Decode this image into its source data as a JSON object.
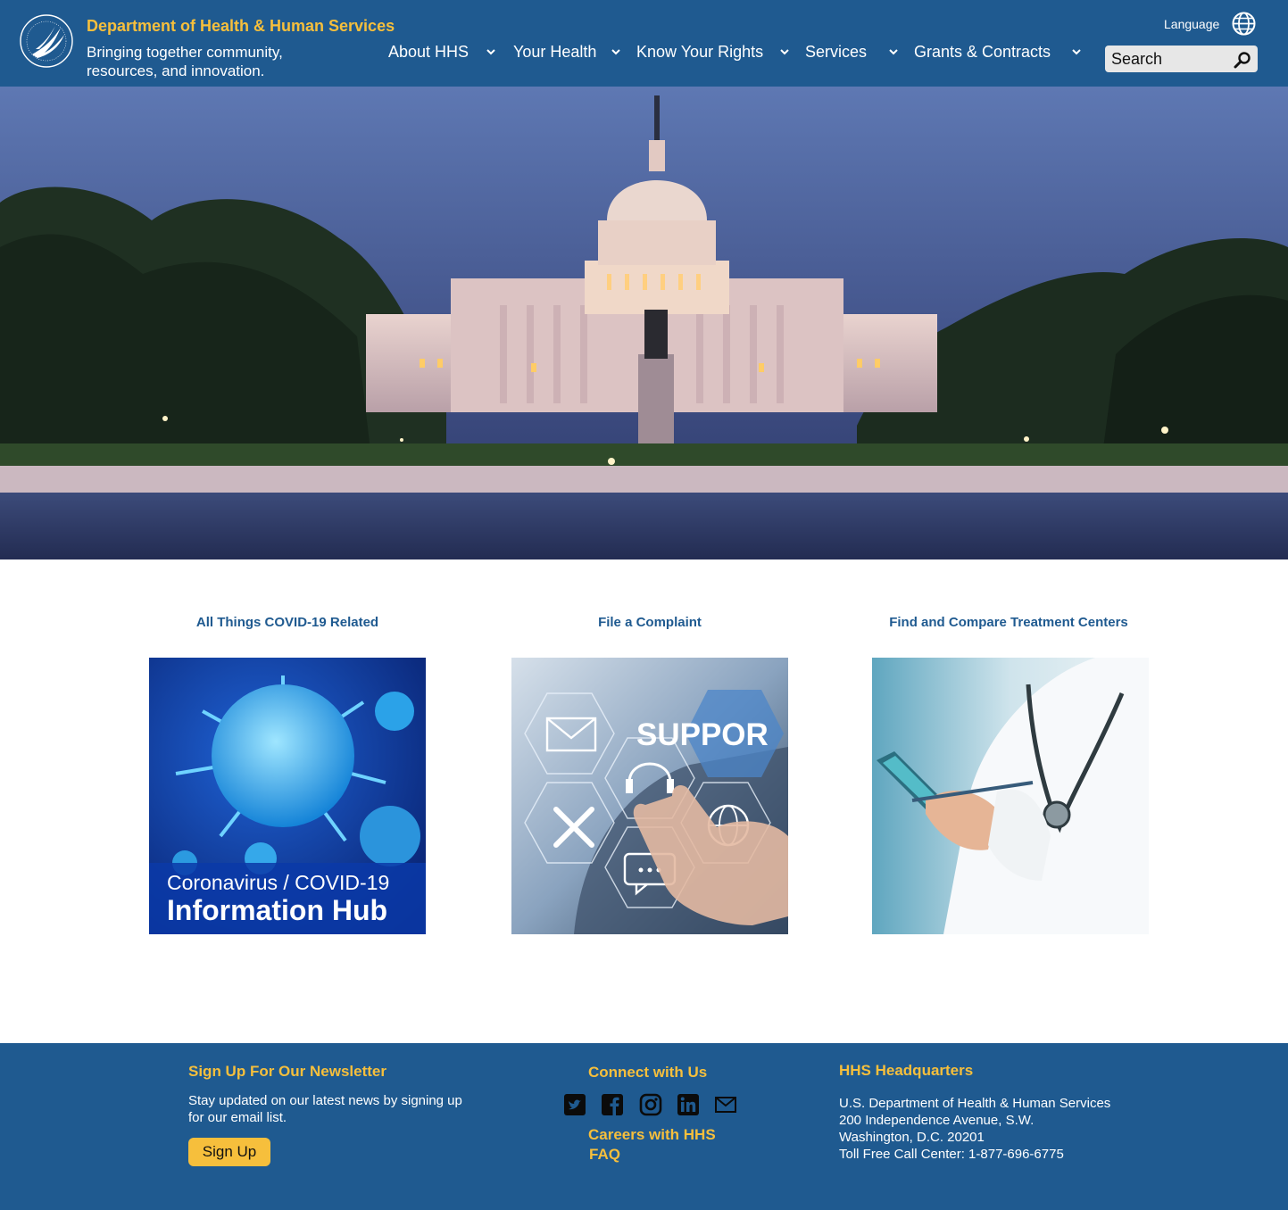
{
  "header": {
    "org_name": "Department of Health & Human Services",
    "tagline": "Bringing together community, resources, and innovation.",
    "language_label": "Language",
    "search_placeholder": "Search",
    "nav": [
      {
        "label": "About HHS"
      },
      {
        "label": "Your Health"
      },
      {
        "label": "Know Your Rights"
      },
      {
        "label": "Services"
      },
      {
        "label": "Grants & Contracts"
      }
    ]
  },
  "cards": [
    {
      "title": "All Things COVID-19 Related",
      "image_line1": "Coronavirus / COVID-19",
      "image_line2": "Information Hub"
    },
    {
      "title": "File a Complaint",
      "image_text": "SUPPOR"
    },
    {
      "title": "Find and Compare Treatment Centers"
    }
  ],
  "footer": {
    "newsletter_heading": "Sign Up For Our Newsletter",
    "newsletter_text": "Stay updated on our latest news by signing up for our email list.",
    "signup_label": "Sign Up",
    "connect_heading": "Connect with Us",
    "careers_link": "Careers with HHS",
    "faq_link": "FAQ",
    "hq_heading": "HHS Headquarters",
    "hq_lines": [
      "U.S. Department of Health & Human Services",
      "200 Independence Avenue, S.W.",
      "Washington, D.C. 20201",
      "Toll Free Call Center: 1-877-696-6775"
    ]
  },
  "colors": {
    "brand_blue": "#1f5a90",
    "accent_gold": "#f6bf3c"
  },
  "icons": [
    "hhs-eagle-logo",
    "globe-icon",
    "search-icon",
    "chevron-down-icon",
    "twitter-icon",
    "facebook-icon",
    "instagram-icon",
    "linkedin-icon",
    "email-icon"
  ]
}
